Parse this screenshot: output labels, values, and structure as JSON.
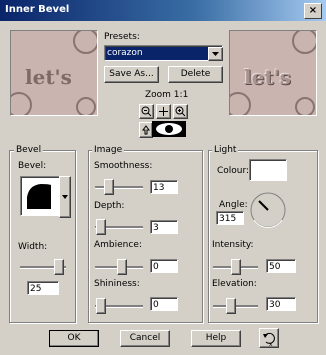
{
  "window": {
    "title": "Inner Bevel",
    "close_glyph": "×"
  },
  "presets": {
    "label": "Presets:",
    "selected": "corazon",
    "save_as": "Save As...",
    "delete": "Delete"
  },
  "preview": {
    "text": "let's"
  },
  "zoom": {
    "label": "Zoom 1:1"
  },
  "bevel": {
    "group": "Bevel",
    "bevel_label": "Bevel:",
    "width_label": "Width:",
    "width": "25"
  },
  "image": {
    "group": "Image",
    "smoothness_label": "Smoothness:",
    "smoothness": "13",
    "depth_label": "Depth:",
    "depth": "3",
    "ambience_label": "Ambience:",
    "ambience": "0",
    "shininess_label": "Shininess:",
    "shininess": "0"
  },
  "light": {
    "group": "Light",
    "colour_label": "Colour:",
    "angle_label": "Angle:",
    "angle": "315",
    "intensity_label": "Intensity:",
    "intensity": "50",
    "elevation_label": "Elevation:",
    "elevation": "30"
  },
  "buttons": {
    "ok": "OK",
    "cancel": "Cancel",
    "help": "Help"
  },
  "colors": {
    "title_bar": "#0a246a",
    "preview_bg": "#c9b4b0",
    "dialog_bg": "#d4d0c8"
  }
}
